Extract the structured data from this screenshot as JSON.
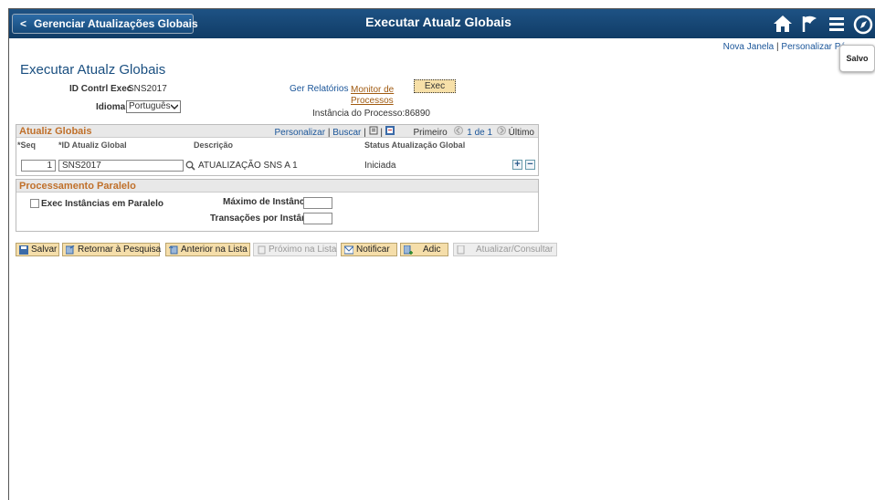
{
  "header": {
    "back_label": "Gerenciar Atualizações Globais",
    "title": "Executar Atualz Globais",
    "icons": [
      "home-icon",
      "flag-icon",
      "menu-icon",
      "compass-icon"
    ]
  },
  "links": {
    "new_window": "Nova Janela",
    "separator": "|",
    "personalize_page": "Personalizar Pá"
  },
  "salvo_label": "Salvo",
  "page": {
    "title": "Executar Atualz Globais",
    "run_control_label": "ID Contrl Exec",
    "run_control_value": "SNS2017",
    "language_label": "Idioma",
    "language_value": "Português",
    "reports_link": "Ger Relatórios",
    "monitor_link_line1": "Monitor de",
    "monitor_link_line2": "Processos",
    "exec_button": "Exec",
    "process_instance": "Instância do Processo:86890"
  },
  "grid": {
    "title": "Atualiz Globais",
    "personalize": "Personalizar",
    "search": "Buscar",
    "first": "Primeiro",
    "range": "1 de 1",
    "last": "Último",
    "columns": [
      "*Seq",
      "*ID Atualiz Global",
      "Descrição",
      "Status Atualização Global"
    ],
    "rows": [
      {
        "seq": "1",
        "id": "SNS2017",
        "description": "ATUALIZAÇÃO SNS A 1",
        "status": "Iniciada"
      }
    ]
  },
  "parallel": {
    "title": "Processamento Paralelo",
    "checkbox_label": "Exec Instâncias em Paralelo",
    "max_instances_label": "Máximo de Instâncias",
    "max_instances_value": "",
    "tx_per_instance_label": "Transações por Instância",
    "tx_per_instance_value": ""
  },
  "toolbar": {
    "save": "Salvar",
    "return_search": "Retornar à Pesquisa",
    "prev_in_list": "Anterior na Lista",
    "next_in_list": "Próximo na Lista",
    "notify": "Notificar",
    "add": "Adic",
    "update_display": "Atualizar/Consultar"
  },
  "colors": {
    "header_bg": "#1a4c7c",
    "section_title": "#c0702a",
    "link": "#1a5599",
    "button_bg": "#f5deaa"
  }
}
